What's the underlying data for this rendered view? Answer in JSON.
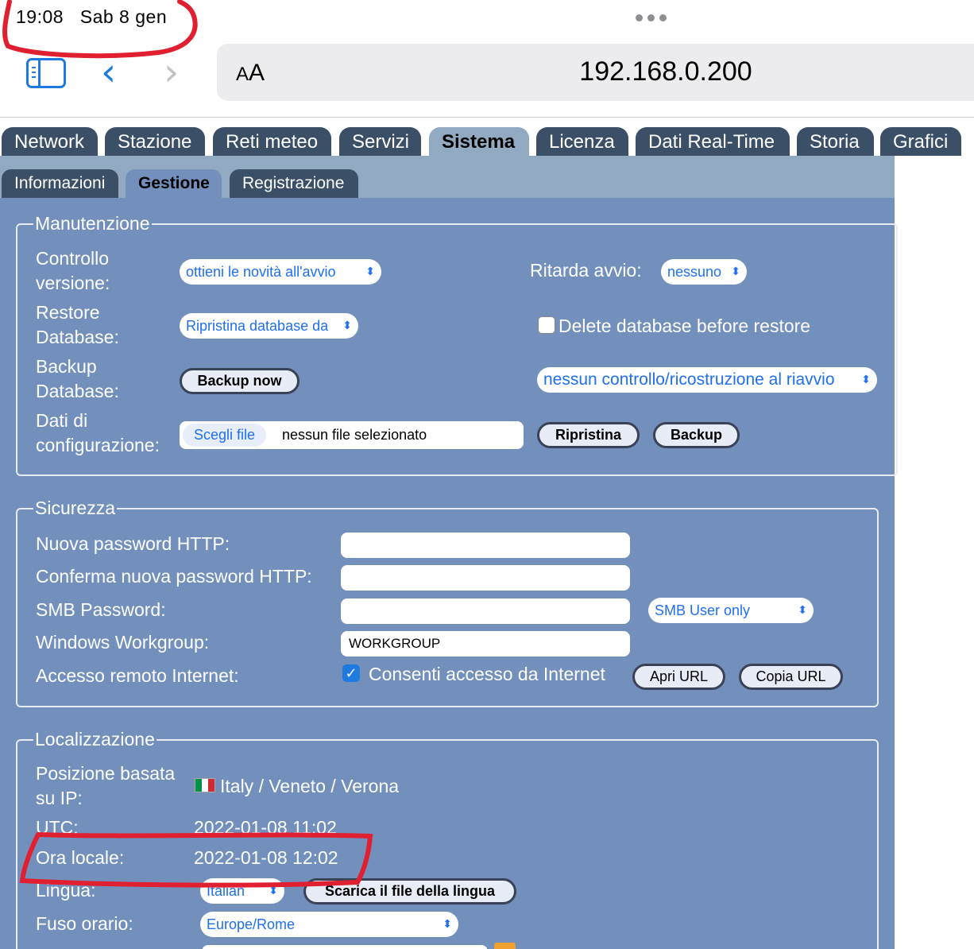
{
  "status_bar": {
    "time": "19:08",
    "date": "Sab 8 gen"
  },
  "browser": {
    "text_size": "AA",
    "url": "192.168.0.200"
  },
  "tabs": [
    "Network",
    "Stazione",
    "Reti meteo",
    "Servizi",
    "Sistema",
    "Licenza",
    "Dati Real-Time",
    "Storia",
    "Grafici"
  ],
  "active_tab": "Sistema",
  "subtabs": [
    "Informazioni",
    "Gestione",
    "Registrazione"
  ],
  "active_subtab": "Gestione",
  "manutenzione": {
    "legend": "Manutenzione",
    "controllo_label_1": "Controllo",
    "controllo_label_2": "versione:",
    "controllo_value": "ottieni le novità all'avvio",
    "ritarda_label": "Ritarda avvio:",
    "ritarda_value": "nessuno",
    "restore_label_1": "Restore",
    "restore_label_2": "Database:",
    "restore_value": "Ripristina database da",
    "delete_label": "Delete database before restore",
    "backup_label_1": "Backup",
    "backup_label_2": "Database:",
    "backup_button": "Backup now",
    "check_value": "nessun controllo/ricostruzione al riavvio",
    "dati_label_1": "Dati di",
    "dati_label_2": "configurazione:",
    "choose_file": "Scegli file",
    "no_file": "nessun file selezionato",
    "ripristina_button": "Ripristina",
    "backup2_button": "Backup"
  },
  "sicurezza": {
    "legend": "Sicurezza",
    "nuova_password_label": "Nuova password HTTP:",
    "conferma_password_label": "Conferma nuova password HTTP:",
    "smb_password_label": "SMB Password:",
    "smb_mode_value": "SMB User only",
    "workgroup_label": "Windows Workgroup:",
    "workgroup_value": "WORKGROUP",
    "accesso_label": "Accesso remoto Internet:",
    "consenti_label": "Consenti accesso da Internet",
    "consenti_checked": true,
    "apri_url_button": "Apri URL",
    "copia_url_button": "Copia URL"
  },
  "localizzazione": {
    "legend": "Localizzazione",
    "posizione_label_1": "Posizione basata",
    "posizione_label_2": "su IP:",
    "posizione_value": "Italy / Veneto / Verona",
    "utc_label": "UTC:",
    "utc_value": "2022-01-08 11:02",
    "ora_label": "Ora locale:",
    "ora_value": "2022-01-08 12:02",
    "lingua_label": "Lingua:",
    "lingua_value": "Italian",
    "scarica_button": "Scarica il file della lingua",
    "fuso_label": "Fuso orario:",
    "fuso_value": "Europe/Rome"
  },
  "colors": {
    "tab_dark": "#3b4f66",
    "tab_strip": "#91aac2",
    "panel": "#7390bd",
    "link_blue": "#1f6ff0",
    "annotation_red": "#e02030"
  }
}
